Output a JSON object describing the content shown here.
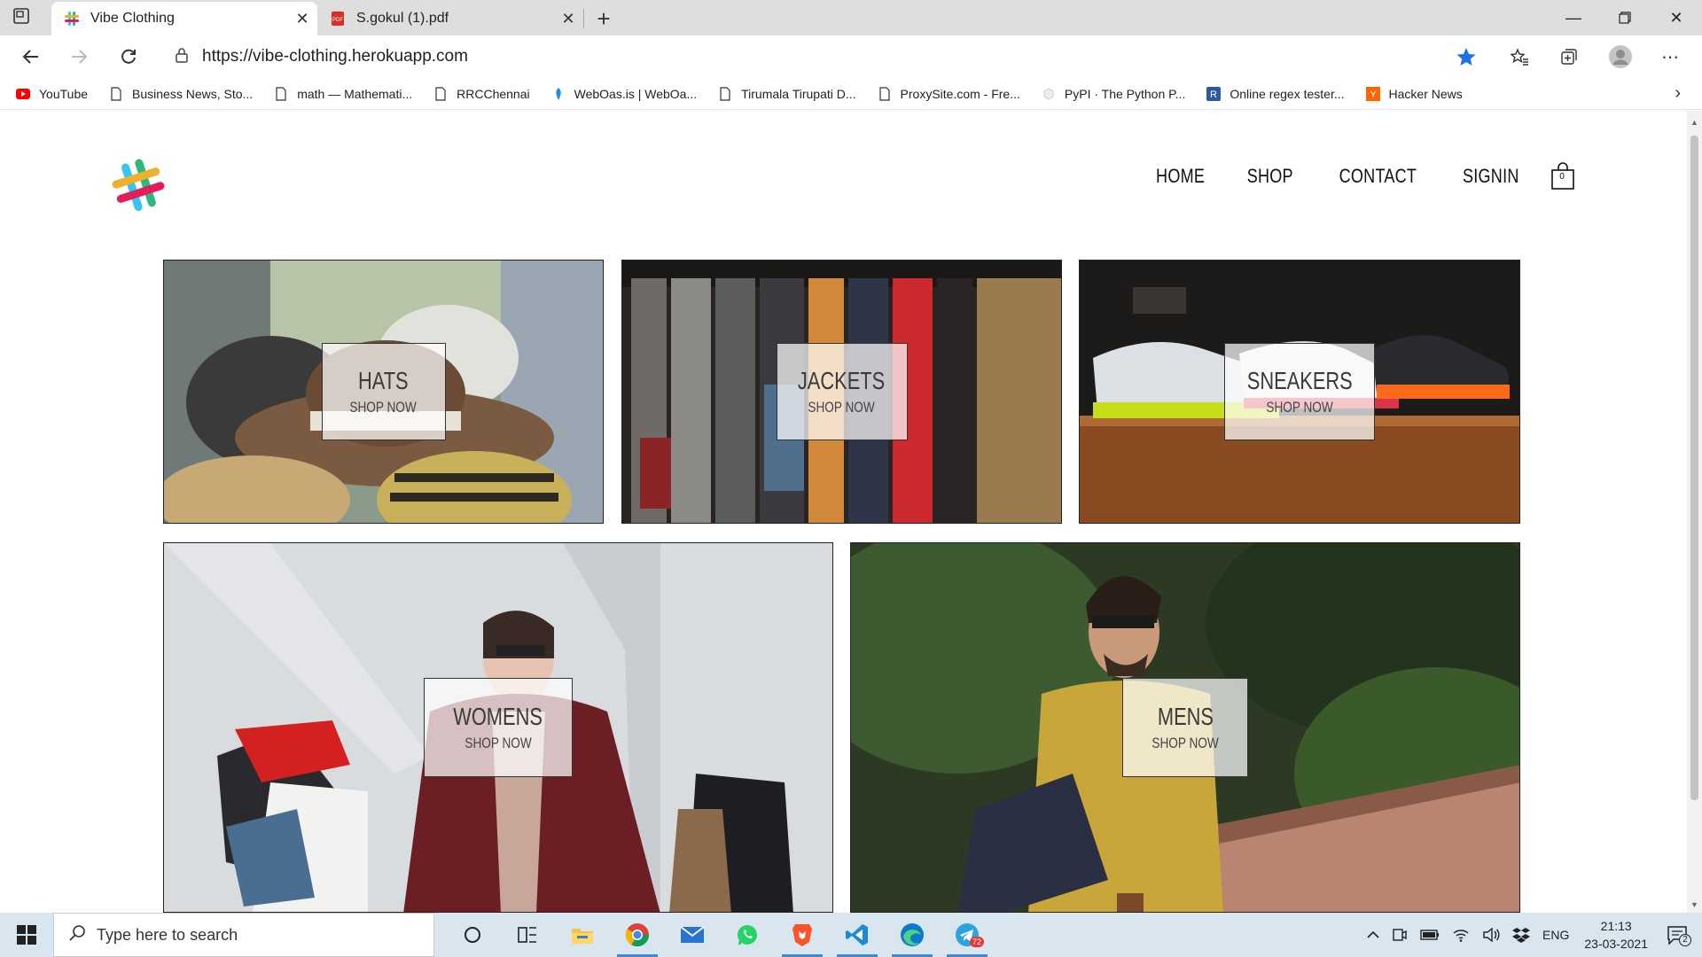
{
  "browser": {
    "tabs": [
      {
        "title": "Vibe Clothing",
        "active": true
      },
      {
        "title": "S.gokul (1).pdf",
        "active": false
      }
    ],
    "url": "https://vibe-clothing.herokuapp.com",
    "bookmarks": [
      {
        "label": "YouTube",
        "icon": "youtube-icon"
      },
      {
        "label": "Business News, Sto...",
        "icon": "page-icon"
      },
      {
        "label": "math — Mathemati...",
        "icon": "page-icon"
      },
      {
        "label": "RRCChennai",
        "icon": "page-icon"
      },
      {
        "label": "WebOas.is | WebOa...",
        "icon": "weboasis-icon"
      },
      {
        "label": "Tirumala Tirupati D...",
        "icon": "page-icon"
      },
      {
        "label": "ProxySite.com - Fre...",
        "icon": "page-icon"
      },
      {
        "label": "PyPI · The Python P...",
        "icon": "pypi-icon"
      },
      {
        "label": "Online regex tester...",
        "icon": "regex-icon"
      },
      {
        "label": "Hacker News",
        "icon": "hackernews-icon"
      }
    ],
    "accent": "#1a73e8"
  },
  "site": {
    "nav": [
      "HOME",
      "SHOP",
      "CONTACT",
      "SIGNIN"
    ],
    "cart_count": "0",
    "categories": [
      {
        "name": "HATS",
        "cta": "SHOP NOW"
      },
      {
        "name": "JACKETS",
        "cta": "SHOP NOW"
      },
      {
        "name": "SNEAKERS",
        "cta": "SHOP NOW"
      },
      {
        "name": "WOMENS",
        "cta": "SHOP NOW"
      },
      {
        "name": "MENS",
        "cta": "SHOP NOW"
      }
    ]
  },
  "taskbar": {
    "search_placeholder": "Type here to search",
    "telegram_badge": "72",
    "language": "ENG",
    "time": "21:13",
    "date": "23-03-2021",
    "notifications": "2"
  }
}
